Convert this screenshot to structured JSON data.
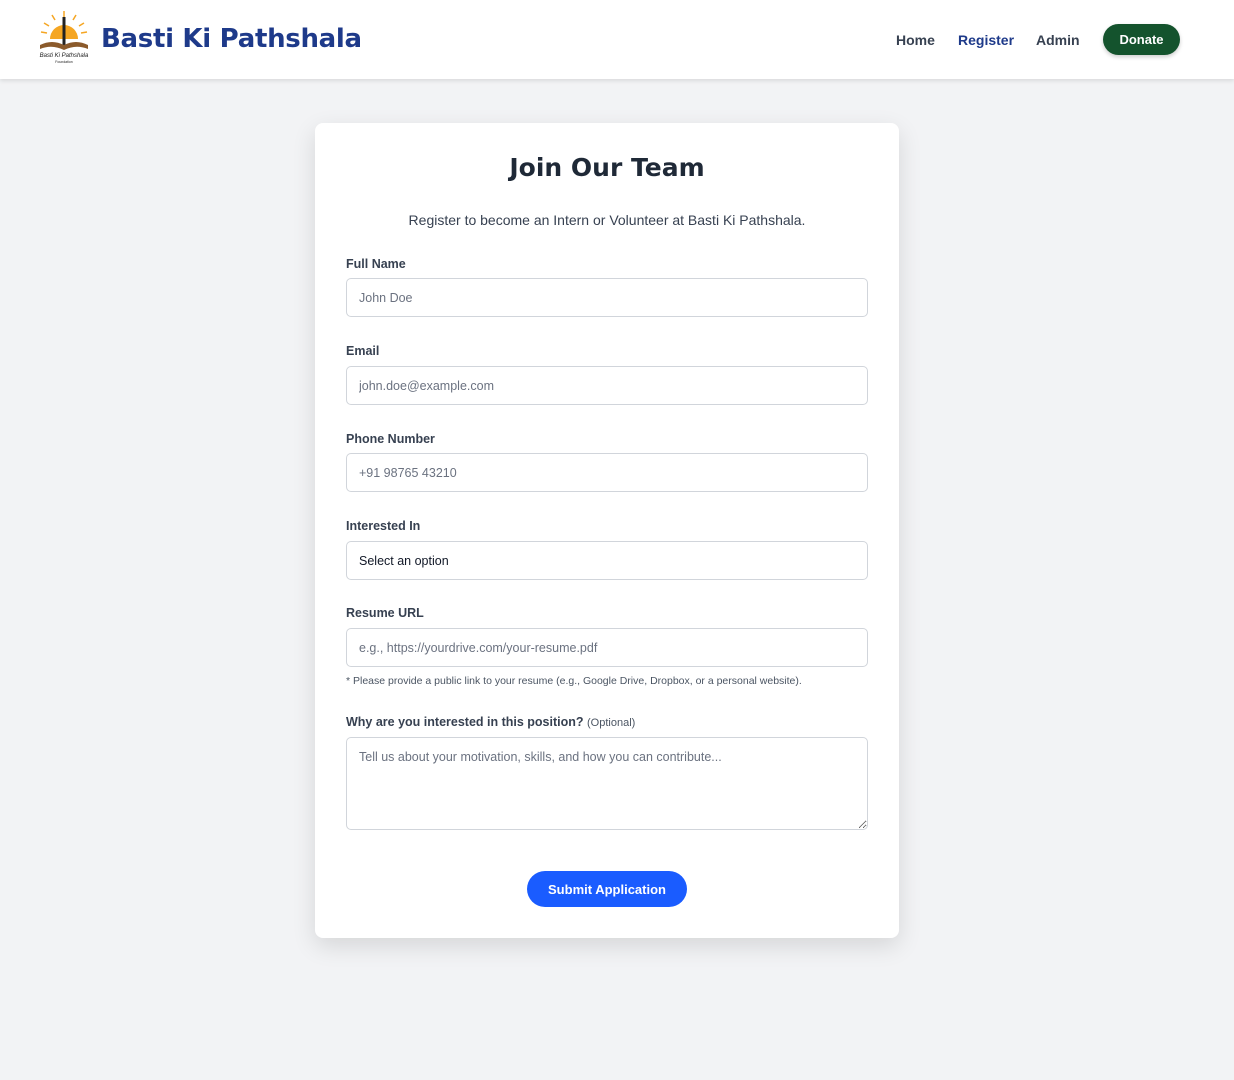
{
  "header": {
    "logo": {
      "text": "Basti Ki Pathshala Foundation",
      "colors": {
        "sun": "#f5a623",
        "book": "#8b5a2b"
      }
    },
    "brand": "Basti Ki Pathshala",
    "nav": [
      {
        "label": "Home",
        "color": "#374151"
      },
      {
        "label": "Register",
        "color": "#1e3a8a"
      },
      {
        "label": "Admin",
        "color": "#374151"
      }
    ],
    "donate": "Donate"
  },
  "form": {
    "title": "Join Our Team",
    "subtitle": "Register to become an Intern or Volunteer at Basti Ki Pathshala.",
    "full_name": {
      "label": "Full Name",
      "placeholder": "John Doe",
      "value": ""
    },
    "email": {
      "label": "Email",
      "placeholder": "john.doe@example.com",
      "value": ""
    },
    "phone": {
      "label": "Phone Number",
      "placeholder": "+91 98765 43210",
      "value": ""
    },
    "interest": {
      "label": "Interested In",
      "selected": "Select an option"
    },
    "resume": {
      "label": "Resume URL",
      "placeholder": "e.g., https://yourdrive.com/your-resume.pdf",
      "value": "",
      "hint": "* Please provide a public link to your resume (e.g., Google Drive, Dropbox, or a personal website)."
    },
    "why": {
      "label": "Why are you interested in this position?",
      "optional": "(Optional)",
      "placeholder": "Tell us about your motivation, skills, and how you can contribute...",
      "value": ""
    },
    "submit": "Submit Application"
  },
  "colors": {
    "brand": "#1e3a8a",
    "donate": "#14532d",
    "submit": "#1a5cff",
    "background": "#f2f3f5"
  }
}
